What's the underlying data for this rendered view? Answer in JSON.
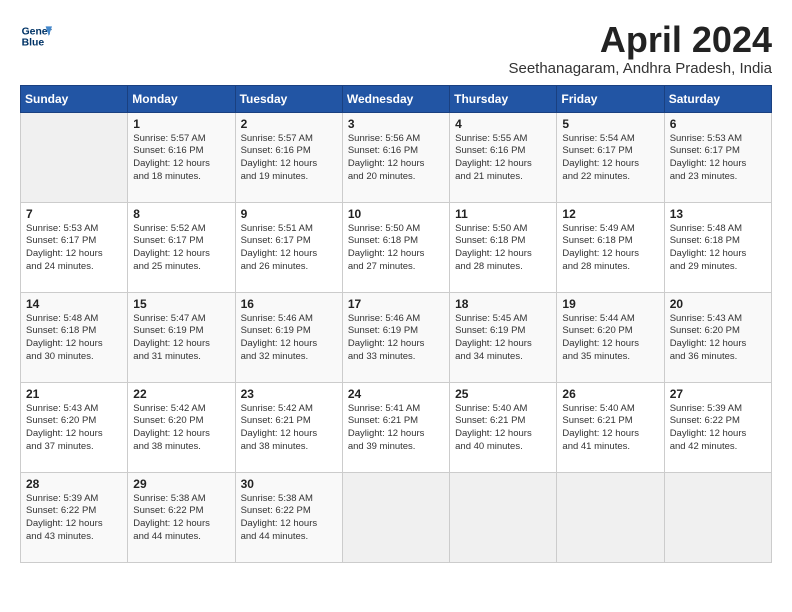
{
  "header": {
    "logo_line1": "General",
    "logo_line2": "Blue",
    "title": "April 2024",
    "location": "Seethanagaram, Andhra Pradesh, India"
  },
  "calendar": {
    "days_of_week": [
      "Sunday",
      "Monday",
      "Tuesday",
      "Wednesday",
      "Thursday",
      "Friday",
      "Saturday"
    ],
    "weeks": [
      [
        {
          "day": "",
          "info": ""
        },
        {
          "day": "1",
          "info": "Sunrise: 5:57 AM\nSunset: 6:16 PM\nDaylight: 12 hours\nand 18 minutes."
        },
        {
          "day": "2",
          "info": "Sunrise: 5:57 AM\nSunset: 6:16 PM\nDaylight: 12 hours\nand 19 minutes."
        },
        {
          "day": "3",
          "info": "Sunrise: 5:56 AM\nSunset: 6:16 PM\nDaylight: 12 hours\nand 20 minutes."
        },
        {
          "day": "4",
          "info": "Sunrise: 5:55 AM\nSunset: 6:16 PM\nDaylight: 12 hours\nand 21 minutes."
        },
        {
          "day": "5",
          "info": "Sunrise: 5:54 AM\nSunset: 6:17 PM\nDaylight: 12 hours\nand 22 minutes."
        },
        {
          "day": "6",
          "info": "Sunrise: 5:53 AM\nSunset: 6:17 PM\nDaylight: 12 hours\nand 23 minutes."
        }
      ],
      [
        {
          "day": "7",
          "info": "Sunrise: 5:53 AM\nSunset: 6:17 PM\nDaylight: 12 hours\nand 24 minutes."
        },
        {
          "day": "8",
          "info": "Sunrise: 5:52 AM\nSunset: 6:17 PM\nDaylight: 12 hours\nand 25 minutes."
        },
        {
          "day": "9",
          "info": "Sunrise: 5:51 AM\nSunset: 6:17 PM\nDaylight: 12 hours\nand 26 minutes."
        },
        {
          "day": "10",
          "info": "Sunrise: 5:50 AM\nSunset: 6:18 PM\nDaylight: 12 hours\nand 27 minutes."
        },
        {
          "day": "11",
          "info": "Sunrise: 5:50 AM\nSunset: 6:18 PM\nDaylight: 12 hours\nand 28 minutes."
        },
        {
          "day": "12",
          "info": "Sunrise: 5:49 AM\nSunset: 6:18 PM\nDaylight: 12 hours\nand 28 minutes."
        },
        {
          "day": "13",
          "info": "Sunrise: 5:48 AM\nSunset: 6:18 PM\nDaylight: 12 hours\nand 29 minutes."
        }
      ],
      [
        {
          "day": "14",
          "info": "Sunrise: 5:48 AM\nSunset: 6:18 PM\nDaylight: 12 hours\nand 30 minutes."
        },
        {
          "day": "15",
          "info": "Sunrise: 5:47 AM\nSunset: 6:19 PM\nDaylight: 12 hours\nand 31 minutes."
        },
        {
          "day": "16",
          "info": "Sunrise: 5:46 AM\nSunset: 6:19 PM\nDaylight: 12 hours\nand 32 minutes."
        },
        {
          "day": "17",
          "info": "Sunrise: 5:46 AM\nSunset: 6:19 PM\nDaylight: 12 hours\nand 33 minutes."
        },
        {
          "day": "18",
          "info": "Sunrise: 5:45 AM\nSunset: 6:19 PM\nDaylight: 12 hours\nand 34 minutes."
        },
        {
          "day": "19",
          "info": "Sunrise: 5:44 AM\nSunset: 6:20 PM\nDaylight: 12 hours\nand 35 minutes."
        },
        {
          "day": "20",
          "info": "Sunrise: 5:43 AM\nSunset: 6:20 PM\nDaylight: 12 hours\nand 36 minutes."
        }
      ],
      [
        {
          "day": "21",
          "info": "Sunrise: 5:43 AM\nSunset: 6:20 PM\nDaylight: 12 hours\nand 37 minutes."
        },
        {
          "day": "22",
          "info": "Sunrise: 5:42 AM\nSunset: 6:20 PM\nDaylight: 12 hours\nand 38 minutes."
        },
        {
          "day": "23",
          "info": "Sunrise: 5:42 AM\nSunset: 6:21 PM\nDaylight: 12 hours\nand 38 minutes."
        },
        {
          "day": "24",
          "info": "Sunrise: 5:41 AM\nSunset: 6:21 PM\nDaylight: 12 hours\nand 39 minutes."
        },
        {
          "day": "25",
          "info": "Sunrise: 5:40 AM\nSunset: 6:21 PM\nDaylight: 12 hours\nand 40 minutes."
        },
        {
          "day": "26",
          "info": "Sunrise: 5:40 AM\nSunset: 6:21 PM\nDaylight: 12 hours\nand 41 minutes."
        },
        {
          "day": "27",
          "info": "Sunrise: 5:39 AM\nSunset: 6:22 PM\nDaylight: 12 hours\nand 42 minutes."
        }
      ],
      [
        {
          "day": "28",
          "info": "Sunrise: 5:39 AM\nSunset: 6:22 PM\nDaylight: 12 hours\nand 43 minutes."
        },
        {
          "day": "29",
          "info": "Sunrise: 5:38 AM\nSunset: 6:22 PM\nDaylight: 12 hours\nand 44 minutes."
        },
        {
          "day": "30",
          "info": "Sunrise: 5:38 AM\nSunset: 6:22 PM\nDaylight: 12 hours\nand 44 minutes."
        },
        {
          "day": "",
          "info": ""
        },
        {
          "day": "",
          "info": ""
        },
        {
          "day": "",
          "info": ""
        },
        {
          "day": "",
          "info": ""
        }
      ]
    ]
  }
}
